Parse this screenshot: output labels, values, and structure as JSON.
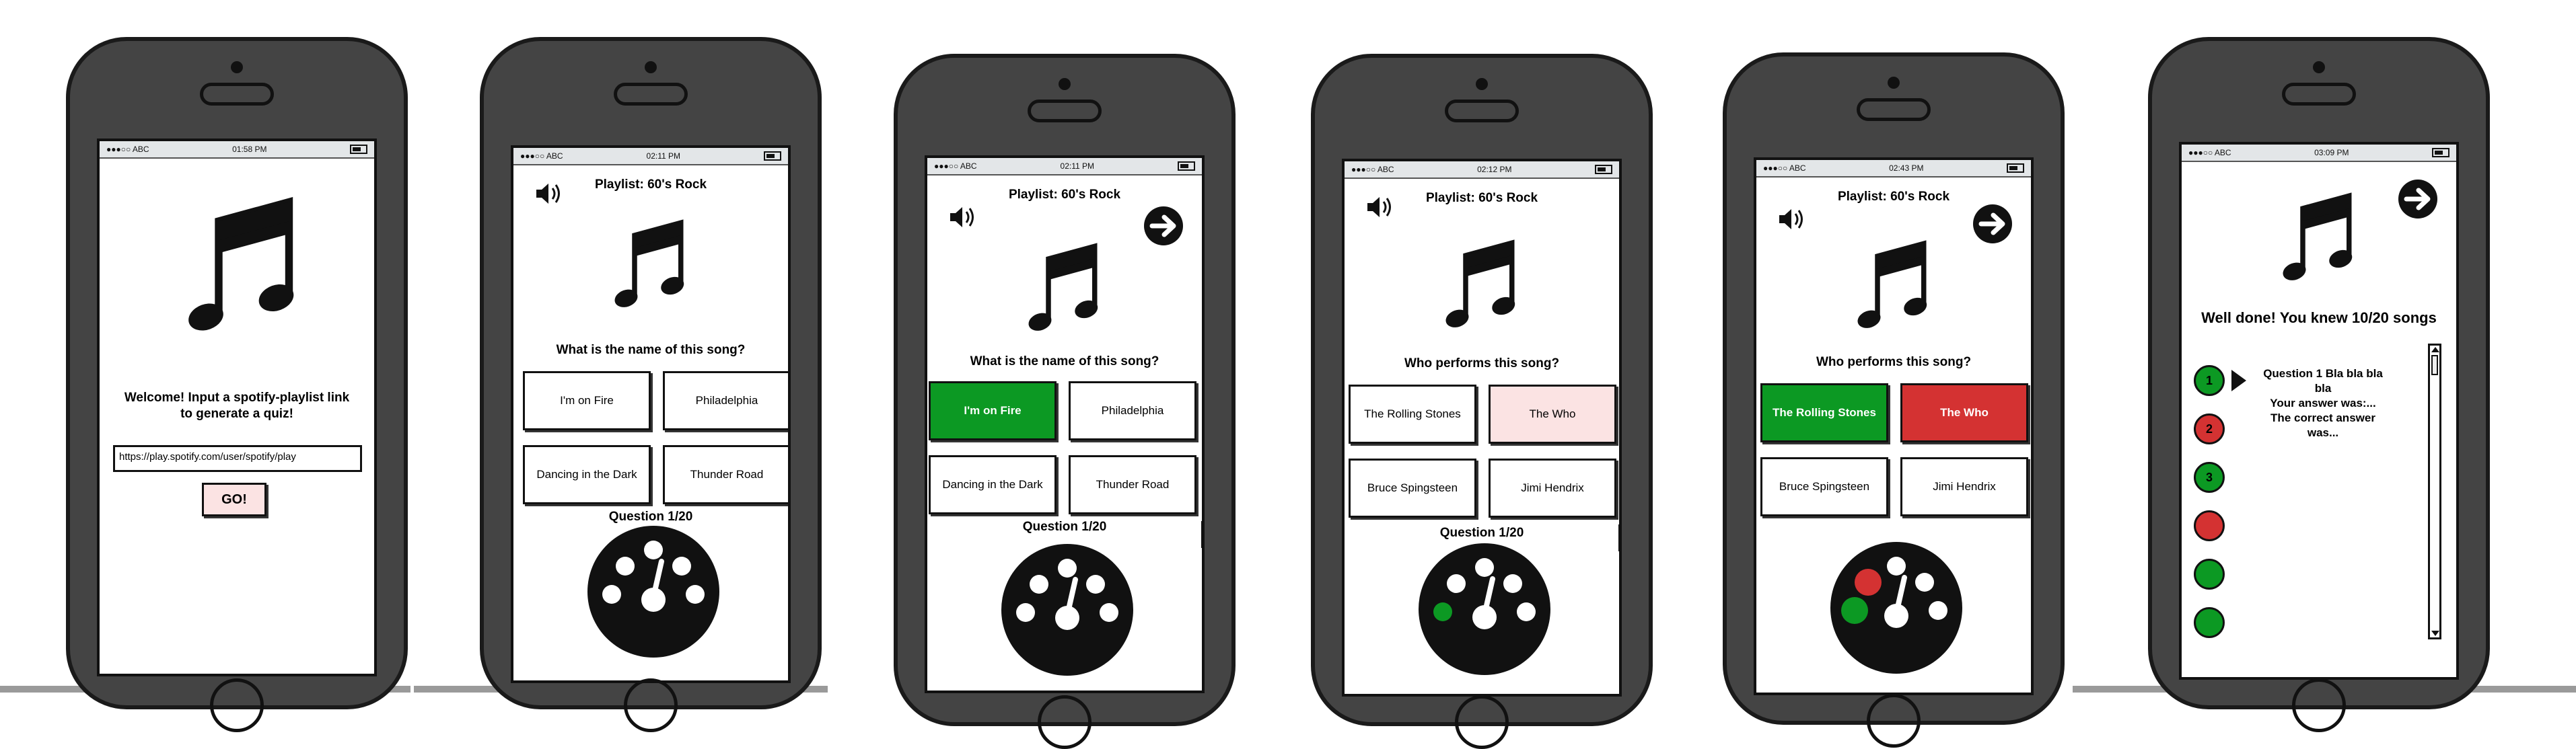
{
  "status": {
    "carrier": "●●●○○ ABC",
    "screens": [
      {
        "time": "01:58 PM"
      },
      {
        "time": "02:11 PM"
      },
      {
        "time": "02:11 PM"
      },
      {
        "time": "02:12 PM"
      },
      {
        "time": "02:43 PM"
      },
      {
        "time": "03:09 PM"
      }
    ]
  },
  "welcome": {
    "line1": "Welcome! Input a spotify-playlist link",
    "line2": "to generate a quiz!",
    "url_value": "https://play.spotify.com/user/spotify/play",
    "go_label": "GO!"
  },
  "quiz": {
    "playlist": "Playlist: 60's Rock",
    "q_name": "What is the name of this song?",
    "q_perform": "Who performs this song?",
    "answers_name": [
      "I'm on Fire",
      "Philadelphia",
      "Dancing in the Dark",
      "Thunder Road"
    ],
    "answers_perform": [
      "The Rolling Stones",
      "The Who",
      "Bruce Spingsteen",
      "Jimi Hendrix"
    ],
    "question_count": "Question 1/20"
  },
  "results": {
    "summary": "Well done! You knew 10/20 songs",
    "items": [
      {
        "label": "1",
        "status": "correct"
      },
      {
        "label": "2",
        "status": "wrong"
      },
      {
        "label": "3",
        "status": "correct"
      },
      {
        "label": "",
        "status": "wrong"
      },
      {
        "label": "",
        "status": "correct"
      },
      {
        "label": "",
        "status": "correct"
      }
    ],
    "detail_line1": "Question 1 Bla bla bla bla",
    "detail_line2": "Your answer was:...",
    "detail_line3": "The correct answer was..."
  },
  "colors": {
    "correct": "#0c9923",
    "wrong": "#d43232",
    "selected": "#fbe3e3"
  },
  "icons": [
    "music-note-icon",
    "speaker-icon",
    "next-arrow-icon",
    "timer-dial-icon"
  ]
}
